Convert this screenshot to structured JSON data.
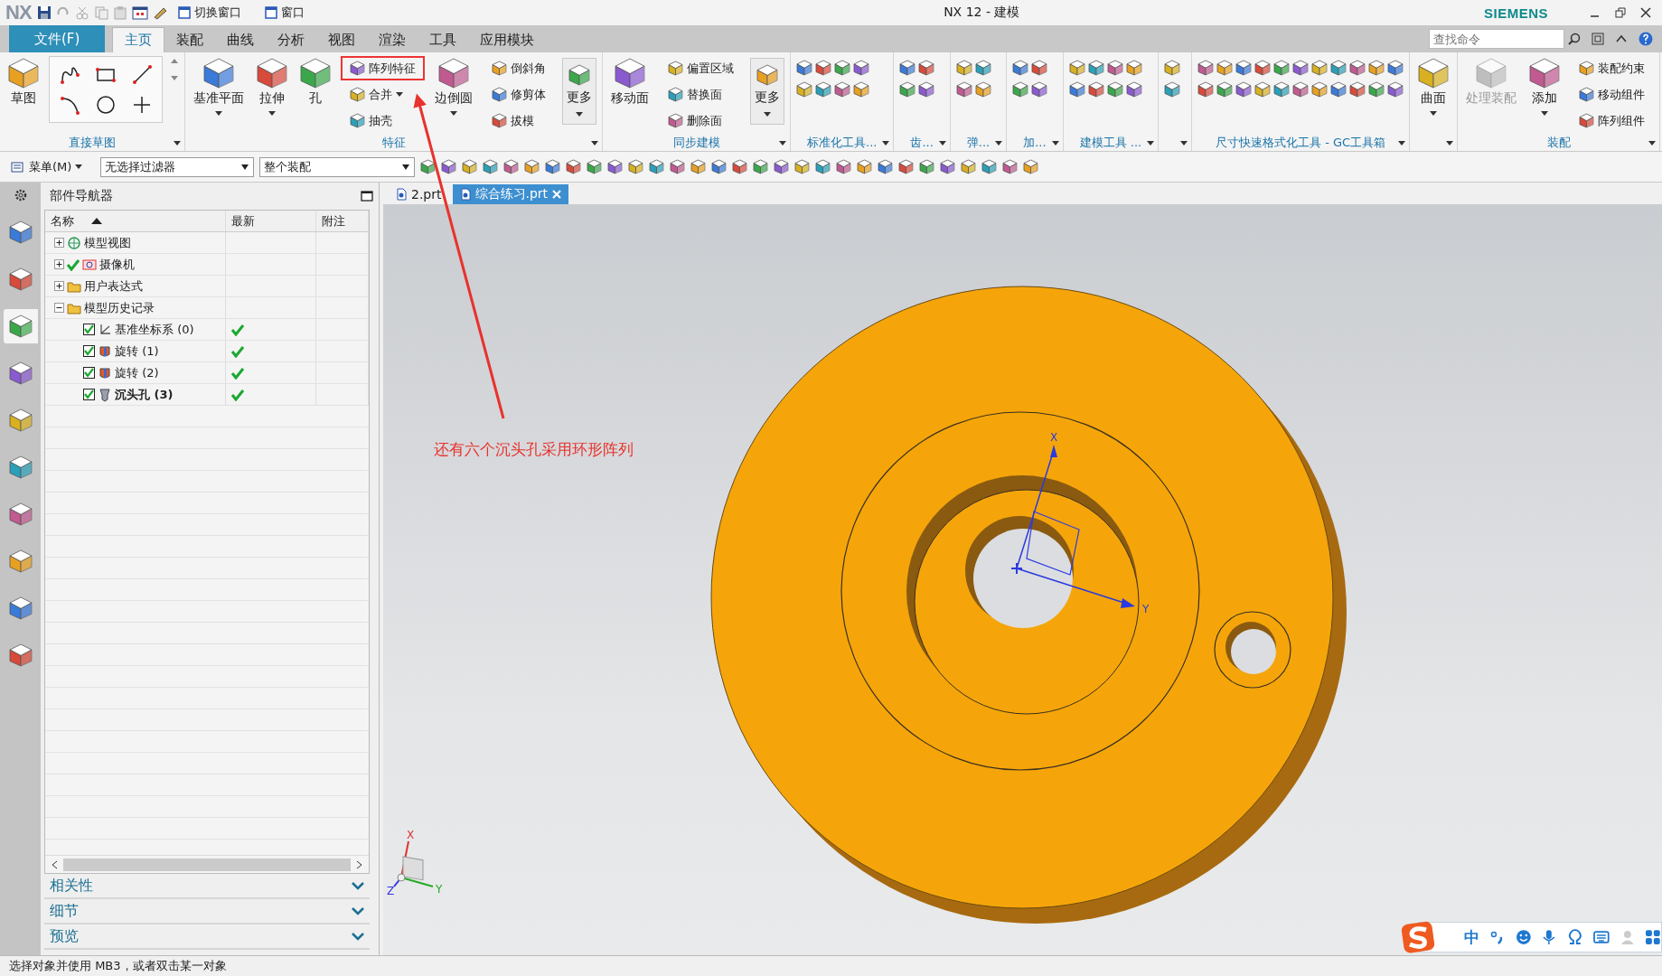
{
  "window": {
    "logo": "NX",
    "title": "NX 12 - 建模",
    "brand": "SIEMENS",
    "quick_access": [
      {
        "kind": "icons"
      },
      {
        "kind": "text",
        "label": "切换窗口"
      },
      {
        "kind": "text",
        "label": "窗口"
      }
    ]
  },
  "menu_tabs": [
    {
      "label": "文件(F)",
      "kind": "file",
      "selected": false
    },
    {
      "label": "主页",
      "kind": "tab",
      "selected": true
    },
    {
      "label": "装配",
      "kind": "tab",
      "selected": false
    },
    {
      "label": "曲线",
      "kind": "tab",
      "selected": false
    },
    {
      "label": "分析",
      "kind": "tab",
      "selected": false
    },
    {
      "label": "视图",
      "kind": "tab",
      "selected": false
    },
    {
      "label": "渲染",
      "kind": "tab",
      "selected": false
    },
    {
      "label": "工具",
      "kind": "tab",
      "selected": false
    },
    {
      "label": "应用模块",
      "kind": "tab",
      "selected": false
    }
  ],
  "search": {
    "placeholder": "查找命令"
  },
  "ribbon": [
    {
      "label": "直接草图",
      "items": [
        {
          "kind": "large",
          "label": "草图",
          "caret": false,
          "disabled": false
        },
        {
          "kind": "sketch_grid"
        }
      ]
    },
    {
      "label": "特征",
      "items": [
        {
          "kind": "large",
          "label": "基准平面",
          "caret": true,
          "disabled": false
        },
        {
          "kind": "large",
          "label": "拉伸",
          "caret": true,
          "disabled": false
        },
        {
          "kind": "large",
          "label": "孔",
          "caret": false,
          "disabled": false
        },
        {
          "kind": "stack",
          "buttons": [
            {
              "label": "阵列特征",
              "highlighted": true,
              "caret": false
            },
            {
              "label": "合并",
              "highlighted": false,
              "caret": true
            },
            {
              "label": "抽壳",
              "highlighted": false,
              "caret": false
            }
          ]
        },
        {
          "kind": "large",
          "label": "边倒圆",
          "caret": true,
          "disabled": false
        },
        {
          "kind": "stack",
          "buttons": [
            {
              "label": "倒斜角",
              "highlighted": false,
              "caret": false
            },
            {
              "label": "修剪体",
              "highlighted": false,
              "caret": false
            },
            {
              "label": "拔模",
              "highlighted": false,
              "caret": false
            }
          ]
        },
        {
          "kind": "more",
          "label": "更多"
        }
      ]
    },
    {
      "label": "同步建模",
      "items": [
        {
          "kind": "large",
          "label": "移动面",
          "caret": false,
          "disabled": false
        },
        {
          "kind": "stack",
          "buttons": [
            {
              "label": "偏置区域",
              "highlighted": false,
              "caret": false
            },
            {
              "label": "替换面",
              "highlighted": false,
              "caret": false
            },
            {
              "label": "删除面",
              "highlighted": false,
              "caret": false
            }
          ]
        },
        {
          "kind": "more",
          "label": "更多"
        }
      ]
    },
    {
      "label": "标准化工具...",
      "items": [
        {
          "kind": "tool_grid"
        }
      ]
    },
    {
      "label": "齿...",
      "items": [
        {
          "kind": "tool_grid"
        }
      ]
    },
    {
      "label": "弹...",
      "items": [
        {
          "kind": "tool_grid"
        }
      ]
    },
    {
      "label": "加...",
      "items": [
        {
          "kind": "tool_grid"
        }
      ]
    },
    {
      "label": "建模工具 ...",
      "items": [
        {
          "kind": "tool_grid"
        }
      ]
    },
    {
      "items": [
        {
          "kind": "tool_grid"
        }
      ]
    },
    {
      "label": "尺寸快速格式化工具 - GC工具箱",
      "items": [
        {
          "kind": "tool_grid"
        }
      ]
    },
    {
      "items": [
        {
          "kind": "large",
          "label": "曲面",
          "caret": true,
          "disabled": false
        }
      ]
    },
    {
      "label": "装配",
      "items": [
        {
          "kind": "large",
          "label": "处理装配",
          "caret": false,
          "disabled": true
        },
        {
          "kind": "large",
          "label": "添加",
          "caret": true,
          "disabled": false
        },
        {
          "kind": "stack",
          "buttons": [
            {
              "label": "装配约束",
              "highlighted": false,
              "caret": false
            },
            {
              "label": "移动组件",
              "highlighted": false,
              "caret": false
            },
            {
              "label": "阵列组件",
              "highlighted": false,
              "caret": false
            }
          ]
        }
      ]
    }
  ],
  "toolbar": {
    "menu": "菜单(M)",
    "filters": [
      {
        "value": "无选择过滤器"
      },
      {
        "value": "整个装配"
      }
    ]
  },
  "resource_bar": [
    {
      "selected": false
    },
    {
      "selected": false
    },
    {
      "selected": true
    },
    {
      "selected": false
    },
    {
      "selected": false
    },
    {
      "selected": false
    },
    {
      "selected": false
    },
    {
      "selected": false
    },
    {
      "selected": false
    },
    {
      "selected": false
    }
  ],
  "navigator": {
    "title": "部件导航器",
    "columns": [
      {
        "label": "名称",
        "sorted": true
      },
      {
        "label": "最新",
        "sorted": false
      },
      {
        "label": "附注",
        "sorted": false
      }
    ],
    "tree": [
      {
        "label": "模型视图",
        "expanded": false,
        "kind": "views"
      },
      {
        "label": "摄像机",
        "expanded": false,
        "kind": "camera"
      },
      {
        "label": "用户表达式",
        "expanded": false,
        "kind": "folder"
      },
      {
        "label": "模型历史记录",
        "expanded": true,
        "kind": "folder",
        "children": [
          {
            "label": "基准坐标系 (0)",
            "kind": "datum",
            "checked": true,
            "up_to_date": true,
            "current": false
          },
          {
            "label": "旋转 (1)",
            "kind": "revolve",
            "checked": true,
            "up_to_date": true,
            "current": false
          },
          {
            "label": "旋转 (2)",
            "kind": "revolve",
            "checked": true,
            "up_to_date": true,
            "current": false
          },
          {
            "label": "沉头孔 (3)",
            "kind": "hole",
            "checked": true,
            "up_to_date": true,
            "current": true
          }
        ]
      }
    ],
    "sections": [
      {
        "label": "相关性",
        "expanded": false
      },
      {
        "label": "细节",
        "expanded": false
      },
      {
        "label": "预览",
        "expanded": false
      }
    ]
  },
  "documents": [
    {
      "label": "2.prt",
      "selected": false
    },
    {
      "label": "综合练习.prt",
      "selected": true
    }
  ],
  "viewport": {
    "annotation": "还有六个沉头孔采用环形阵列",
    "wcs": {
      "x": "X",
      "y": "Y"
    },
    "triad": {
      "x": "X",
      "y": "Y",
      "z": "Z"
    }
  },
  "ime": {
    "mode": "中"
  },
  "status_bar": {
    "text": "选择对象并使用 MB3，或者双击某一对象"
  }
}
